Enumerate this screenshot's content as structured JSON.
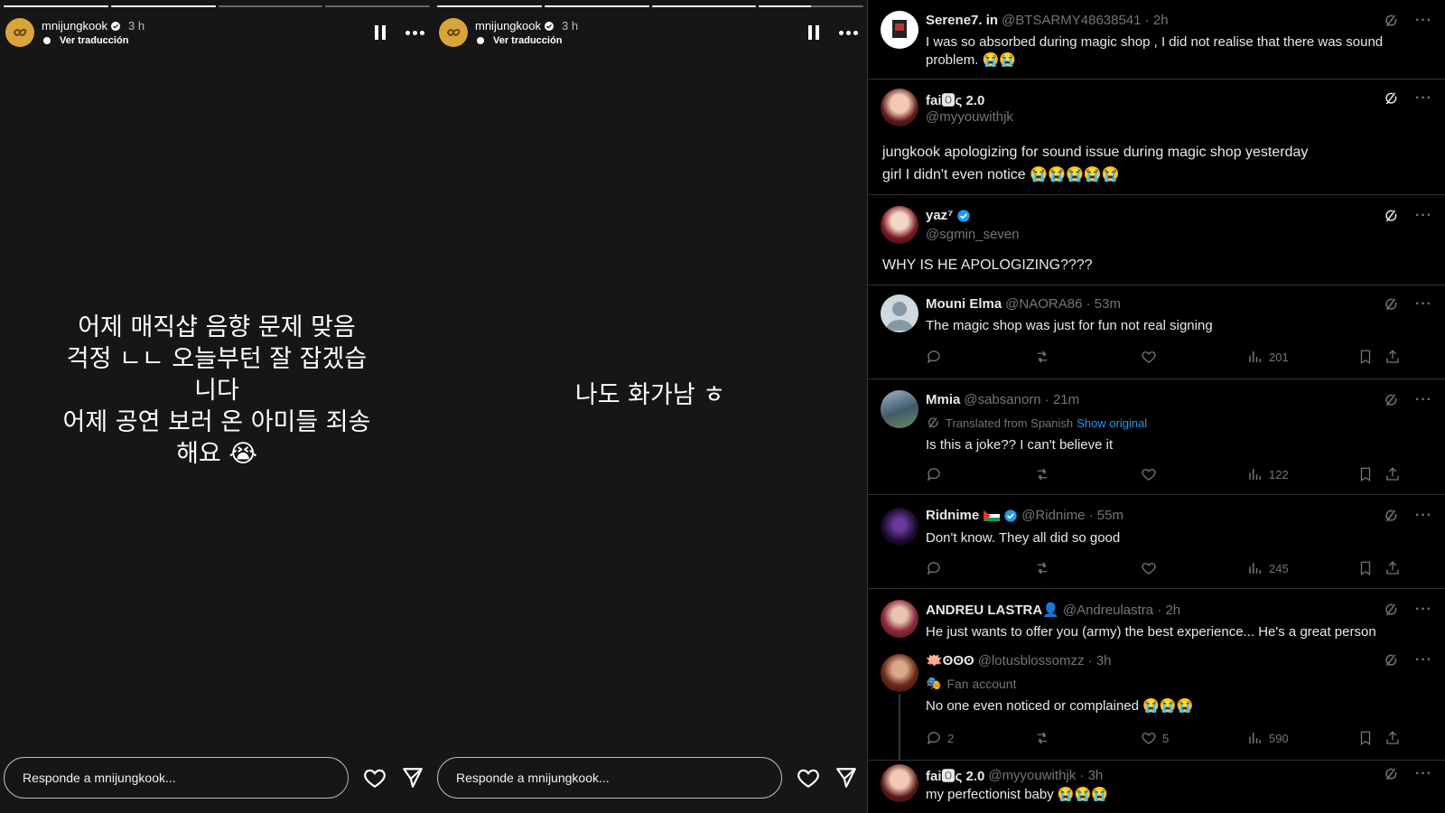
{
  "story1": {
    "progress": [
      1,
      1,
      0,
      0
    ],
    "username": "mnijungkook",
    "time": "3 h",
    "translate_label": "Ver traducción",
    "text": "어제 매직샵 음향 문제 맞음\n걱정 ㄴㄴ 오늘부턴 잘 잡겠습\n니다\n어제 공연 보러 온 아미들 죄송\n해요 😭",
    "reply_placeholder": "Responde a mnijungkook..."
  },
  "story2": {
    "progress": [
      1,
      1,
      1,
      0.5
    ],
    "username": "mnijungkook",
    "time": "3 h",
    "translate_label": "Ver traducción",
    "text": "나도 화가남 ㅎ",
    "reply_placeholder": "Responde a mnijungkook..."
  },
  "tweets": [
    {
      "name": "Serene7. in",
      "handle": "@BTSARMY48638541 · 2h",
      "text": "I was so absorbed during magic shop , I did not realise that there was sound problem. 😭😭"
    },
    {
      "name": "fai🅾ς 2.0",
      "handle": "@myyouwithjk",
      "text": "jungkook apologizing for sound issue during magic shop yesterday\ngirl I didn't even notice 😭😭😭😭😭"
    },
    {
      "name": "yaz⁷",
      "handle": "@sgmin_seven",
      "text": "WHY IS HE APOLOGIZING????"
    },
    {
      "name": "Mouni Elma",
      "handle": "@NAORA86 · 53m",
      "text": "The magic shop was just for fun not real signing",
      "views": "201"
    },
    {
      "name": "Mmia",
      "handle": "@sabsanorn · 21m",
      "translated": "Translated from Spanish",
      "show_original": "Show original",
      "text": "Is this a joke?? I can't believe it",
      "views": "122"
    },
    {
      "name": "Ridnime",
      "handle": "@Ridnime · 55m",
      "text": "Don't know. They all did so good",
      "views": "245"
    },
    {
      "name": "ANDREU LASTRA👤",
      "handle": "@Andreulastra · 2h",
      "text": "He just wants to offer you (army) the best experience... He's a great person"
    },
    {
      "name": "🪷ʘʘʘ",
      "handle": "@lotusblossomzz · 3h",
      "sub": "Fan account",
      "text": "No one even noticed or complained 😭😭😭",
      "replies": "2",
      "likes": "5",
      "views": "590"
    },
    {
      "name": "fai🅾ς 2.0",
      "handle": "@myyouwithjk · 3h",
      "text": "my perfectionist baby 😭😭😭"
    }
  ],
  "colors": {
    "story_bg": "#161616",
    "twitter_bg": "#000000",
    "link": "#1d9bf0",
    "muted": "#71767b",
    "avatar_gold": "#d8a43c"
  }
}
